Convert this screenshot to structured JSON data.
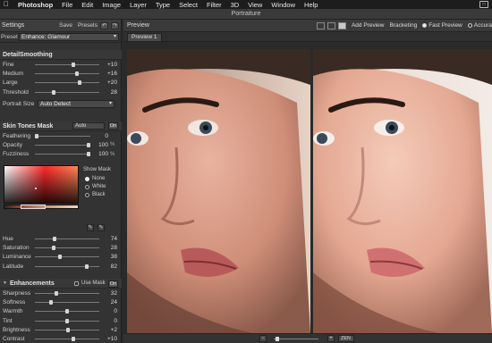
{
  "menubar": {
    "app": "Photoshop",
    "items": [
      "File",
      "Edit",
      "Image",
      "Layer",
      "Type",
      "Select",
      "Filter",
      "3D",
      "View",
      "Window",
      "Help"
    ]
  },
  "window_title": "Portraiture",
  "settings": {
    "title": "Settings",
    "save_label": "Save",
    "presets_label": "Presets",
    "preset_label": "Preset",
    "preset_value": "Enhance: Glamour"
  },
  "detail_smoothing": {
    "title": "DetailSmoothing",
    "sliders": [
      {
        "name": "Fine",
        "value": "+10",
        "level": 0.6
      },
      {
        "name": "Medium",
        "value": "+16",
        "level": 0.66
      },
      {
        "name": "Large",
        "value": "+20",
        "level": 0.7
      },
      {
        "name": "Threshold",
        "value": "28",
        "level": 0.28
      }
    ],
    "portrait_size_label": "Portrait Size",
    "portrait_size_value": "Auto Detect"
  },
  "skin_tones": {
    "title": "Skin Tones Mask",
    "mode_value": "Auto",
    "on_label": "On",
    "sliders": [
      {
        "name": "Feathering",
        "value": "0",
        "unit": "",
        "level": 0.0
      },
      {
        "name": "Opacity",
        "value": "100",
        "unit": "%",
        "level": 1.0
      },
      {
        "name": "Fuzziness",
        "value": "100",
        "unit": "%",
        "level": 1.0
      }
    ],
    "show_mask_label": "Show Mask",
    "show_mask_options": [
      "None",
      "White",
      "Black"
    ],
    "show_mask_selected": "None",
    "hsl": [
      {
        "name": "Hue",
        "value": "74",
        "level": 0.29
      },
      {
        "name": "Saturation",
        "value": "28",
        "level": 0.28
      },
      {
        "name": "Luminance",
        "value": "38",
        "level": 0.38
      },
      {
        "name": "Latitude",
        "value": "82",
        "level": 0.82
      }
    ]
  },
  "enhancements": {
    "title": "Enhancements",
    "use_mask_label": "Use Mask",
    "on_label": "On",
    "sliders": [
      {
        "name": "Sharpness",
        "value": "32",
        "level": 0.32
      },
      {
        "name": "Softness",
        "value": "24",
        "level": 0.24
      },
      {
        "name": "Warmth",
        "value": "0",
        "level": 0.5
      },
      {
        "name": "Tint",
        "value": "0",
        "level": 0.5
      },
      {
        "name": "Brightness",
        "value": "+2",
        "level": 0.52
      },
      {
        "name": "Contrast",
        "value": "+10",
        "level": 0.6
      }
    ]
  },
  "preview": {
    "title": "Preview",
    "add_preview_label": "Add Preview",
    "bracketing_label": "Bracketing",
    "fast_preview_label": "Fast Preview",
    "accurate_label": "Accura",
    "tab_label": "Preview 1",
    "zoom_value": "ZEN",
    "zoom_minus": "−",
    "zoom_plus": "+"
  },
  "colors": {
    "accent": "#c8c8c8",
    "panel": "#333333",
    "skin_light": "#f0c2b0",
    "skin_mid": "#d9957e",
    "bg_dark": "#2b2b2b"
  }
}
